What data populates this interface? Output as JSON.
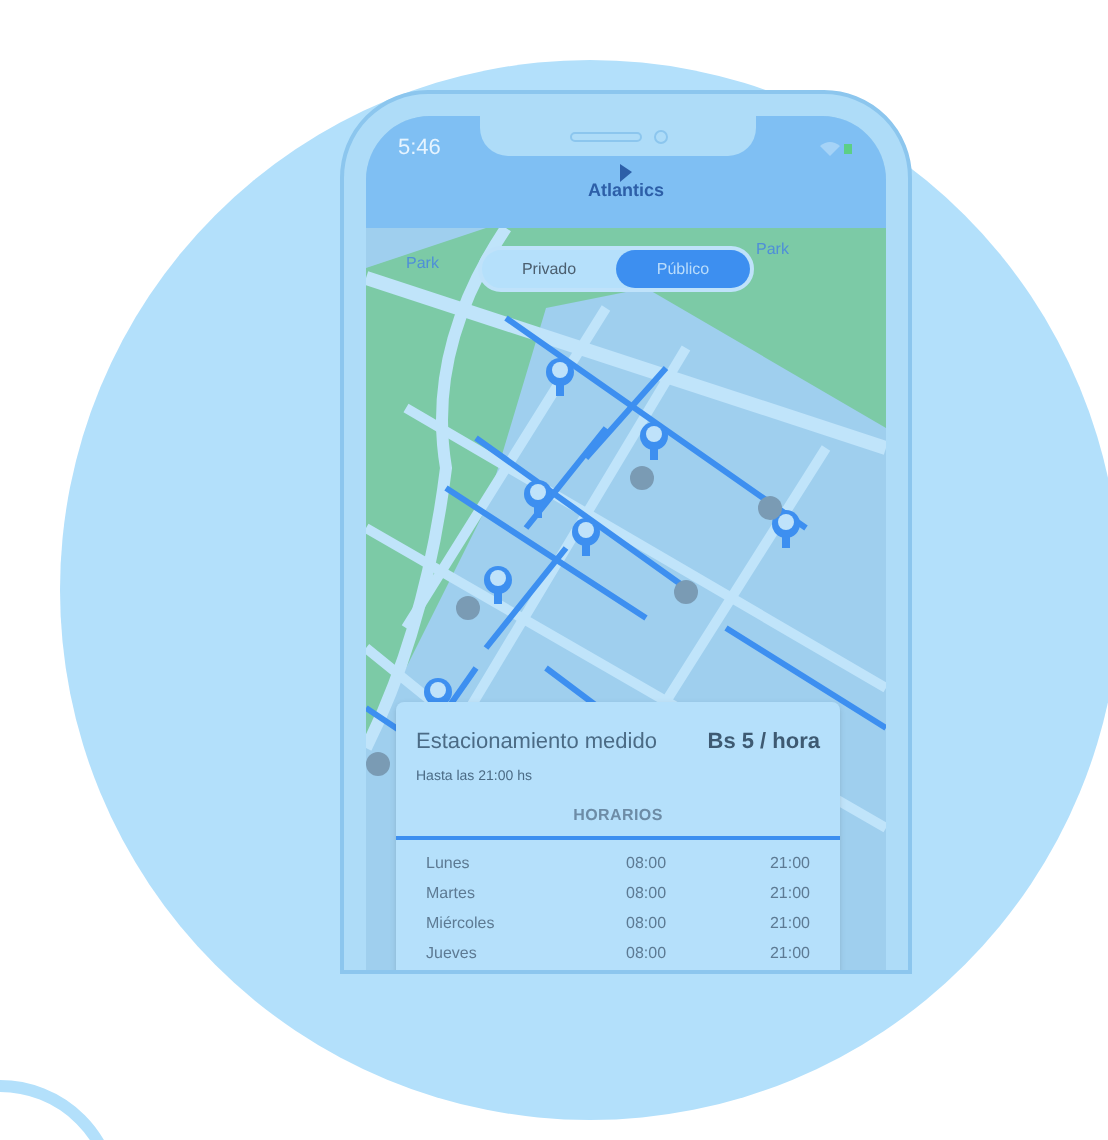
{
  "status_bar": {
    "time": "5:46"
  },
  "header": {
    "logo": "Atlantics"
  },
  "map": {
    "labels": [
      "Park",
      "Park"
    ]
  },
  "segmented": [
    {
      "label": "Privado",
      "selected": false
    },
    {
      "label": "Público",
      "selected": true
    }
  ],
  "card": {
    "title": "Estacionamiento medido",
    "price": "Bs 5 / hora",
    "subtitle": "Hasta las 21:00 hs",
    "section": "HORARIOS",
    "rows": [
      {
        "day": "Lunes",
        "open": "08:00",
        "close": "21:00"
      },
      {
        "day": "Martes",
        "open": "08:00",
        "close": "21:00"
      },
      {
        "day": "Miércoles",
        "open": "08:00",
        "close": "21:00"
      },
      {
        "day": "Jueves",
        "open": "08:00",
        "close": "21:00"
      }
    ]
  }
}
